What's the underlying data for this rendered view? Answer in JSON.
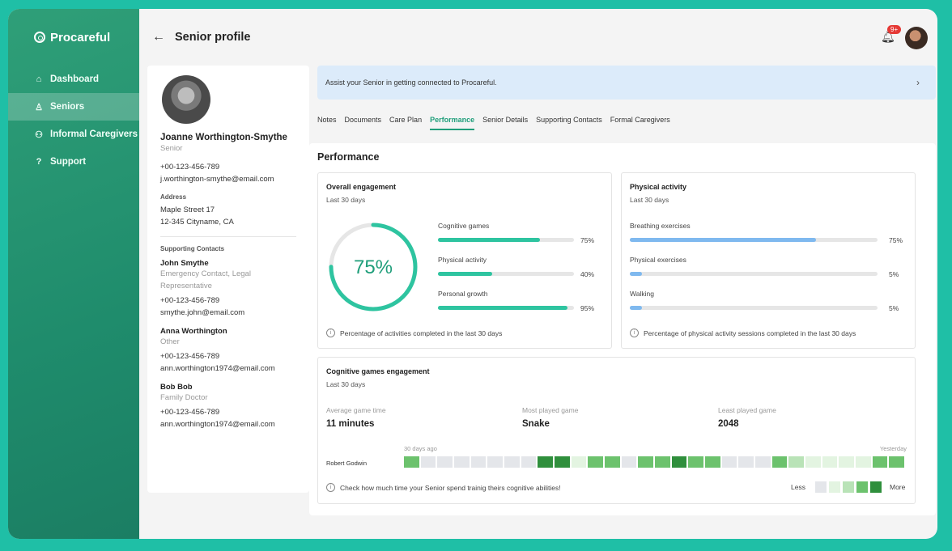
{
  "brand": "Procareful",
  "nav": [
    {
      "label": "Dashboard",
      "icon": "home-icon"
    },
    {
      "label": "Seniors",
      "icon": "person-icon",
      "active": true
    },
    {
      "label": "Informal Caregivers",
      "icon": "people-icon"
    },
    {
      "label": "Support",
      "icon": "help-icon"
    }
  ],
  "header": {
    "back": "←",
    "title": "Senior profile",
    "notification_badge": "9+"
  },
  "senior": {
    "name": "Joanne Worthington-Smythe",
    "role": "Senior",
    "phone": "+00-123-456-789",
    "email": "j.worthington-smythe@email.com",
    "address_label": "Address",
    "address_line1": "Maple Street 17",
    "address_line2": "12-345 Cityname, CA"
  },
  "supporting_contacts": {
    "label": "Supporting Contacts",
    "contacts": [
      {
        "name": "John Smythe",
        "role_line1": "Emergency Contact, Legal",
        "role_line2": "Representative",
        "phone": "+00-123-456-789",
        "email": "smythe.john@email.com"
      },
      {
        "name": "Anna Worthington",
        "role_line1": "Other",
        "phone": "+00-123-456-789",
        "email": "ann.worthington1974@email.com"
      },
      {
        "name": "Bob Bob",
        "role_line1": "Family Doctor",
        "phone": "+00-123-456-789",
        "email": "ann.worthington1974@email.com"
      }
    ]
  },
  "banner": {
    "text": "Assist your Senior in getting connected to Procareful.",
    "chevron": "›"
  },
  "tabs": [
    "Notes",
    "Documents",
    "Care Plan",
    "Performance",
    "Senior Details",
    "Supporting Contacts",
    "Formal Caregivers"
  ],
  "active_tab": "Performance",
  "performance": {
    "title": "Performance",
    "overall": {
      "title": "Overall engagement",
      "subtitle": "Last 30 days",
      "value": 75,
      "value_label": "75%",
      "items": [
        {
          "label": "Cognitive games",
          "value": 75,
          "pct": "75%"
        },
        {
          "label": "Physical activity",
          "value": 40,
          "pct": "40%"
        },
        {
          "label": "Personal growth",
          "value": 95,
          "pct": "95%"
        }
      ],
      "info": "Percentage of activities completed in the last 30 days"
    },
    "physical": {
      "title": "Physical activity",
      "subtitle": "Last 30 days",
      "items": [
        {
          "label": "Breathing exercises",
          "value": 75,
          "pct": "75%"
        },
        {
          "label": "Physical exercises",
          "value": 5,
          "pct": "5%"
        },
        {
          "label": "Walking",
          "value": 5,
          "pct": "5%"
        }
      ],
      "info": "Percentage of physical activity sessions completed in the last 30 days"
    },
    "cognitive": {
      "title": "Cognitive games engagement",
      "subtitle": "Last 30 days",
      "stats": [
        {
          "label": "Average game time",
          "value": "11 minutes"
        },
        {
          "label": "Most played game",
          "value": "Snake"
        },
        {
          "label": "Least played game",
          "value": "2048"
        }
      ],
      "range_start": "30 days ago",
      "range_end": "Yesterday",
      "row_label": "Robert Godwin",
      "levels": [
        3,
        0,
        0,
        0,
        0,
        0,
        0,
        0,
        4,
        4,
        1,
        3,
        3,
        0,
        3,
        3,
        4,
        3,
        3,
        0,
        0,
        0,
        3,
        2,
        1,
        1,
        1,
        1,
        3,
        3
      ],
      "info": "Check how much time your Senior spend trainig theirs cognitive abilities!",
      "legend_less": "Less",
      "legend_more": "More"
    }
  },
  "colors": {
    "accent": "#1f9e7a",
    "teal_bar": "#2ec4a0",
    "blue_bar": "#7fb9ef",
    "heat": [
      "#e4e6ea",
      "#e3f4e1",
      "#b9e3b7",
      "#6cc26d",
      "#2f8f3c"
    ]
  }
}
